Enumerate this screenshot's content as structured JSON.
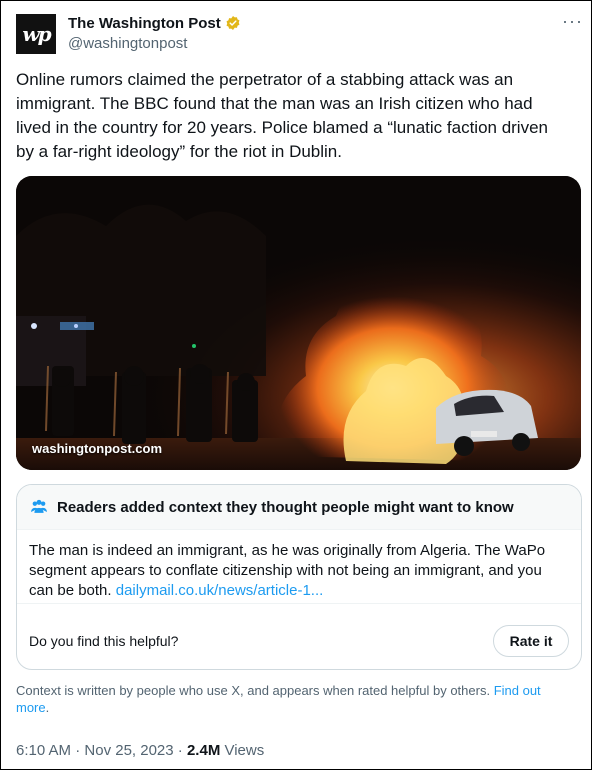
{
  "account": {
    "display_name": "The Washington Post",
    "handle": "@washingtonpost",
    "avatar_text": "wp",
    "more_label": "···"
  },
  "tweet": {
    "lines": [
      "Online rumors claimed the perpetrator of a stabbing attack was an",
      "immigrant. The BBC found that the man was an Irish citizen who had",
      "lived in the country for 20 years. Police blamed a “lunatic faction driven",
      "by a far-right ideology” for the riot in Dublin."
    ]
  },
  "media": {
    "caption": "washingtonpost.com"
  },
  "community_note": {
    "header": "Readers added context they thought people might want to know",
    "body_lines": [
      "The man is indeed an immigrant, as he was originally from Algeria. The WaPo",
      "segment appears to conflate citizenship with  not being an immigrant, and you"
    ],
    "body_last_prefix": "can be both. ",
    "link_text": "dailymail.co.uk/news/article-1...",
    "helpful_prompt": "Do you find this helpful?",
    "rate_button": "Rate it"
  },
  "context_footer": {
    "text": "Context is written by people who use X, and appears when rated helpful by others. ",
    "link_text": "Find out more",
    "trailing": "."
  },
  "meta": {
    "time": "6:10 AM",
    "separator": " · ",
    "date": "Nov 25, 2023",
    "views_count": "2.4M",
    "views_label": " Views"
  },
  "colors": {
    "accent": "#1d9bf0",
    "verified_gold": "#e2b719",
    "secondary_text": "#536471"
  },
  "icons": [
    "verified-badge-icon",
    "more-options-icon",
    "community-notes-icon"
  ]
}
